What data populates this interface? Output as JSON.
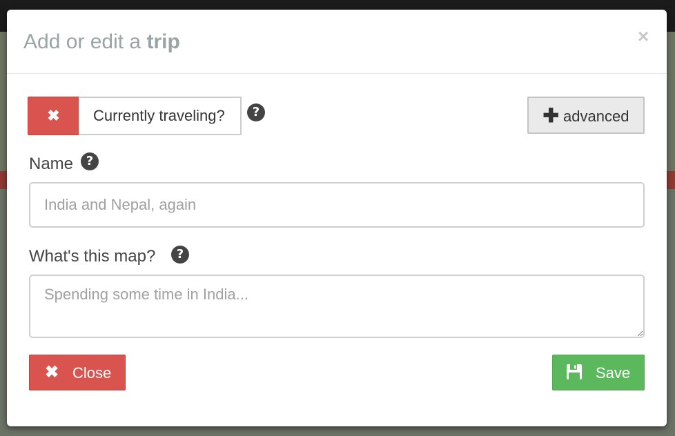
{
  "modal": {
    "title_prefix": "Add or edit a",
    "title_emphasis": "trip",
    "close_symbol": "×"
  },
  "toggle": {
    "off_symbol": "✖",
    "label": "Currently traveling?",
    "state": "off"
  },
  "help_symbol": "?",
  "advanced": {
    "plus_symbol": "✚",
    "label": "advanced"
  },
  "name_field": {
    "label": "Name",
    "value": "",
    "placeholder": "India and Nepal, again"
  },
  "map_field": {
    "label": "What's this map?",
    "value": "",
    "placeholder": "Spending some time in India..."
  },
  "footer": {
    "close_symbol": "✖",
    "close_label": "Close",
    "save_label": "Save"
  },
  "icons": {
    "toggle": "times-icon",
    "help": "question-circle-icon",
    "advanced": "plus-icon",
    "close": "times-icon",
    "save": "floppy-disk-icon"
  },
  "colors": {
    "danger": "#d9534f",
    "success": "#5cb85c",
    "title": "#9aa4a6",
    "help_icon": "#444444"
  }
}
